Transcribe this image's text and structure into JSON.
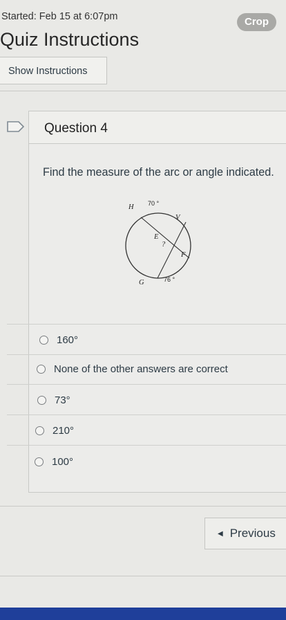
{
  "header": {
    "started": "Started: Feb 15 at 6:07pm",
    "crop_label": "Crop",
    "title": "Quiz Instructions",
    "show_instructions_label": "Show Instructions"
  },
  "question": {
    "title": "Question 4",
    "text": "Find the measure of the arc or angle indicated.",
    "diagram": {
      "labels": {
        "h": "H",
        "v": "V",
        "e": "E",
        "q": "?",
        "f": "F",
        "g": "G"
      },
      "arc_top": "70 °",
      "arc_bottom": "76 °"
    },
    "options": [
      {
        "label": "160°"
      },
      {
        "label": "None of the other answers are correct"
      },
      {
        "label": "73°"
      },
      {
        "label": "210°"
      },
      {
        "label": "100°"
      }
    ]
  },
  "nav": {
    "previous_label": "Previous",
    "previous_icon": "triangle-left-icon"
  },
  "colors": {
    "accent_bar": "#1f3f9a",
    "crop_bg": "#a9a9a6"
  }
}
